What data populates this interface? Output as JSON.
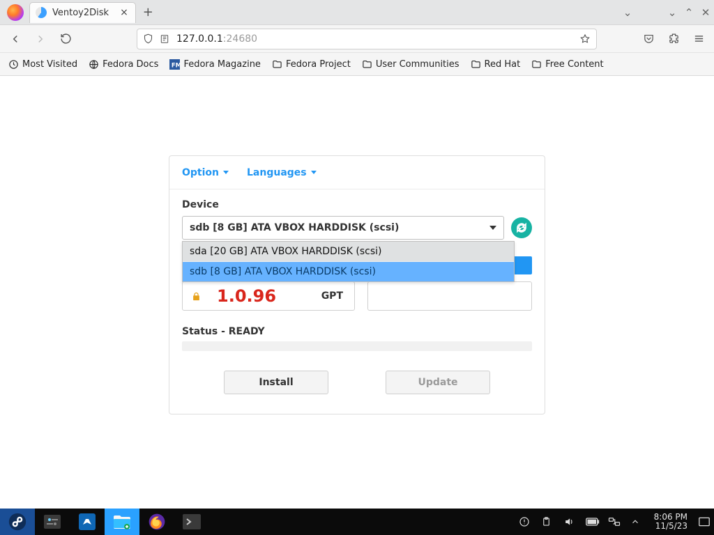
{
  "browser": {
    "tab_title": "Ventoy2Disk",
    "url_main": "127.0.0.1",
    "url_port": ":24680"
  },
  "bookmarks": {
    "most_visited": "Most Visited",
    "fedora_docs": "Fedora Docs",
    "fedora_magazine": "Fedora Magazine",
    "fedora_project": "Fedora Project",
    "user_communities": "User Communities",
    "red_hat": "Red Hat",
    "free_content": "Free Content"
  },
  "ventoy": {
    "menus": {
      "option": "Option",
      "languages": "Languages"
    },
    "device_label": "Device",
    "device_selected": "sdb  [8 GB]  ATA VBOX HARDDISK (scsi)",
    "device_options": {
      "0": "sda  [20 GB]  ATA VBOX HARDDISK (scsi)",
      "1": "sdb  [8 GB]  ATA VBOX HARDDISK (scsi)"
    },
    "version": "1.0.96",
    "part_style": "GPT",
    "status": "Status - READY",
    "buttons": {
      "install": "Install",
      "update": "Update"
    }
  },
  "taskbar": {
    "time": "8:06 PM",
    "date": "11/5/23"
  }
}
